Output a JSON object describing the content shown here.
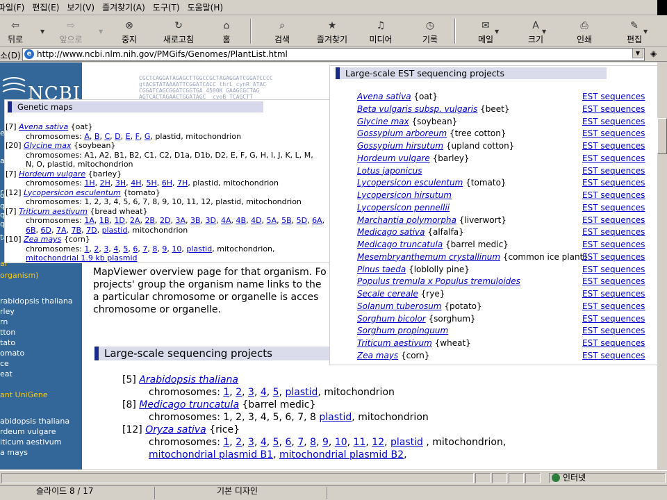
{
  "menu": [
    "파일(F)",
    "편집(E)",
    "보기(V)",
    "즐겨찾기(A)",
    "도구(T)",
    "도움말(H)"
  ],
  "toolbar": {
    "back": "뒤로",
    "forward": "앞으로",
    "stop": "중지",
    "refresh": "새로고침",
    "home": "홈",
    "search": "검색",
    "favorites": "즐겨찾기",
    "media": "미디어",
    "history": "기록",
    "mail": "메일",
    "size": "크기",
    "print": "인쇄",
    "edit": "편집"
  },
  "address": {
    "label": "소(D)",
    "url": "http://www.ncbi.nlm.nih.gov/PMGifs/Genomes/PlantList.html",
    "go": "◈"
  },
  "sidebar": {
    "logo": "NCBI",
    "items": [
      "e",
      "al",
      "r",
      "oj",
      "q",
      "q",
      "q",
      "ta",
      "al",
      "organism)",
      "rabidopsis thaliana",
      "rley",
      "rn",
      "tton",
      "tato",
      "omato",
      "ce",
      "eat",
      "ant UniGene",
      "abidopsis thaliana",
      "rdeum vulgare",
      "iticum aestivum",
      "a mays"
    ]
  },
  "dna_text": "CGCTCAGGATAGAGCTTGGCCGCTAGAGGATCGGATCCCC\ngtACGTATAAAATTCGGATCACC thrL cynR ATAC\nCGGATCAGCGGATCGGTGA 4500K GAAGCGCTAG\nAGTCACTAGAACTGGATAGC  cyoB TCAGCTT",
  "main": {
    "para": [
      "MapViewer overview page for that organism. Fo",
      "projects' group the organism name links to the",
      "a particular chromosome or organelle is acces",
      "chromosome or organelle."
    ],
    "seq_heading": "Large-scale sequencing projects",
    "seq_projects": [
      {
        "count": "[5]",
        "name": "Arabidopsis thaliana",
        "common": "",
        "chrom_label": "chromosomes:",
        "chroms": [
          "1",
          "2",
          "3",
          "4",
          "5"
        ],
        "plastid": "plastid",
        "mito": "mitochondrion",
        "extra": []
      },
      {
        "count": "[8]",
        "name": "Medicago truncatula",
        "common": "{barrel medic}",
        "chrom_label": "chromosomes:",
        "chrom_text": "1, 2, 3, 4, 5, 6, 7, 8",
        "plastid": "plastid",
        "mito": "mitochondrion",
        "extra": []
      },
      {
        "count": "[12]",
        "name": "Oryza sativa",
        "common": "{rice}",
        "chrom_label": "chromosomes:",
        "chroms": [
          "1",
          "2",
          "3",
          "4",
          "5",
          "6",
          "7",
          "8",
          "9",
          "10",
          "11",
          "12"
        ],
        "plastid": "plastid",
        "mito": "mitochondrion,",
        "extra": [
          "mitochondrial plasmid B1",
          "mitochondrial plasmid B2"
        ]
      }
    ]
  },
  "genetic": {
    "heading": "Genetic maps",
    "entries": [
      {
        "count": "[7]",
        "name": "Avena sativa",
        "common": "{oat}",
        "label": "chromosomes:",
        "links": [
          "A",
          "B",
          "C",
          "D",
          "E",
          "F",
          "G"
        ],
        "tail": "plastid, mitochondrion"
      },
      {
        "count": "[20]",
        "name": "Glycine max",
        "common": "{soybean}",
        "label": "chromosomes:",
        "text": "A1, A2, B1, B2, C1, C2, D1a, D1b, D2, E, F, G, H, I, J, K, L, M,",
        "text2": "N, O, plastid, mitochondrion"
      },
      {
        "count": "[7]",
        "name": "Hordeum vulgare",
        "common": "{barley}",
        "label": "chromosomes:",
        "links": [
          "1H",
          "2H",
          "3H",
          "4H",
          "5H",
          "6H",
          "7H"
        ],
        "tail": "plastid, mitochondrion"
      },
      {
        "count": "[12]",
        "name": "Lycopersicon esculentum",
        "common": "{tomato}",
        "label": "chromosomes:",
        "text": "1, 2, 3, 4, 5, 6, 7, 8, 9, 10, 11, 12, plastid, mitochondrion"
      },
      {
        "count": "[7]",
        "name": "Triticum aestivum",
        "common": "{bread wheat}",
        "label": "chromosomes:",
        "links": [
          "1A",
          "1B",
          "1D",
          "2A",
          "2B",
          "2D",
          "3A",
          "3B",
          "3D",
          "4A",
          "4B",
          "4D",
          "5A",
          "5B",
          "5D",
          "6A"
        ],
        "links2": [
          "6B",
          "6D",
          "7A",
          "7B",
          "7D",
          "plastid"
        ],
        "tail2": "mitochondrion"
      },
      {
        "count": "[10]",
        "name": "Zea mays",
        "common": "{corn}",
        "label": "chromosomes:",
        "links": [
          "1",
          "2",
          "3",
          "4",
          "5",
          "6",
          "7",
          "8",
          "9",
          "10",
          "plastid"
        ],
        "tail": "mitochondrion,",
        "extra": "mitochondrial 1.9 kb plasmid"
      }
    ]
  },
  "est": {
    "heading": "Large-scale EST sequencing projects",
    "link_label": "EST sequences",
    "rows": [
      {
        "name": "Avena sativa",
        "common": "{oat}"
      },
      {
        "name": "Beta vulgaris subsp. vulgaris",
        "common": "{beet}"
      },
      {
        "name": "Glycine max",
        "common": "{soybean}"
      },
      {
        "name": "Gossypium arboreum",
        "common": "{tree cotton}"
      },
      {
        "name": "Gossypium hirsutum",
        "common": "{upland cotton}"
      },
      {
        "name": "Hordeum vulgare",
        "common": "{barley}"
      },
      {
        "name": "Lotus japonicus",
        "common": ""
      },
      {
        "name": "Lycopersicon esculentum",
        "common": "{tomato}"
      },
      {
        "name": "Lycopersicon hirsutum",
        "common": ""
      },
      {
        "name": "Lycopersicon pennellii",
        "common": ""
      },
      {
        "name": "Marchantia polymorpha",
        "common": "{liverwort}"
      },
      {
        "name": "Medicago sativa",
        "common": "{alfalfa}"
      },
      {
        "name": "Medicago truncatula",
        "common": "{barrel medic}"
      },
      {
        "name": "Mesembryanthemum crystallinum",
        "common": "{common ice plant}"
      },
      {
        "name": "Pinus taeda",
        "common": "{loblolly pine}"
      },
      {
        "name": "Populus tremula x Populus tremuloides",
        "common": ""
      },
      {
        "name": "Secale cereale",
        "common": "{rye}"
      },
      {
        "name": "Solanum tuberosum",
        "common": "{potato}"
      },
      {
        "name": "Sorghum bicolor",
        "common": "{sorghum}"
      },
      {
        "name": "Sorghum propinquum",
        "common": ""
      },
      {
        "name": "Triticum aestivum",
        "common": "{wheat}"
      },
      {
        "name": "Zea mays",
        "common": "{corn}"
      }
    ]
  },
  "status": {
    "zone": "인터넷"
  },
  "ppt": {
    "slide": "슬라이드 8 / 17",
    "design": "기본 디자인"
  }
}
